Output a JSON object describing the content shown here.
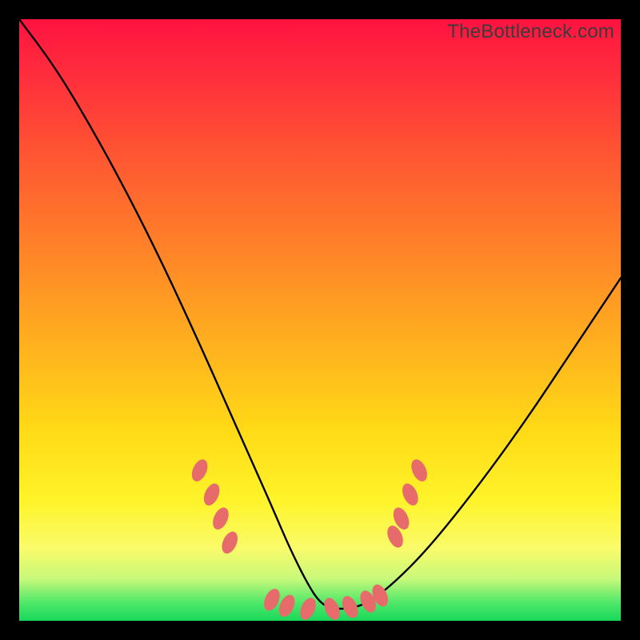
{
  "watermark": "TheBottleneck.com",
  "colors": {
    "curve_stroke": "#000000",
    "marker_fill": "#e76b6b",
    "marker_stroke": "#e76b6b"
  },
  "chart_data": {
    "type": "line",
    "title": "",
    "xlabel": "",
    "ylabel": "",
    "xlim": [
      0,
      100
    ],
    "ylim": [
      0,
      100
    ],
    "series": [
      {
        "name": "curve",
        "x": [
          0,
          6,
          12,
          18,
          24,
          30,
          34,
          38,
          42,
          45,
          48,
          50,
          52,
          55,
          58,
          62,
          68,
          76,
          84,
          92,
          100
        ],
        "y": [
          100,
          92,
          82,
          71,
          59,
          46,
          37,
          28,
          19,
          12,
          6,
          3,
          2,
          2,
          3,
          6,
          12,
          22,
          33,
          45,
          57
        ]
      }
    ],
    "markers": [
      {
        "x": 30,
        "y": 25
      },
      {
        "x": 32,
        "y": 21
      },
      {
        "x": 33.5,
        "y": 17
      },
      {
        "x": 35,
        "y": 13
      },
      {
        "x": 42,
        "y": 3.5
      },
      {
        "x": 44.5,
        "y": 2.5
      },
      {
        "x": 48,
        "y": 2
      },
      {
        "x": 52,
        "y": 2
      },
      {
        "x": 55,
        "y": 2.3
      },
      {
        "x": 58,
        "y": 3.2
      },
      {
        "x": 60,
        "y": 4.2
      },
      {
        "x": 62.5,
        "y": 14
      },
      {
        "x": 63.5,
        "y": 17
      },
      {
        "x": 65,
        "y": 21
      },
      {
        "x": 66.5,
        "y": 25
      }
    ]
  }
}
